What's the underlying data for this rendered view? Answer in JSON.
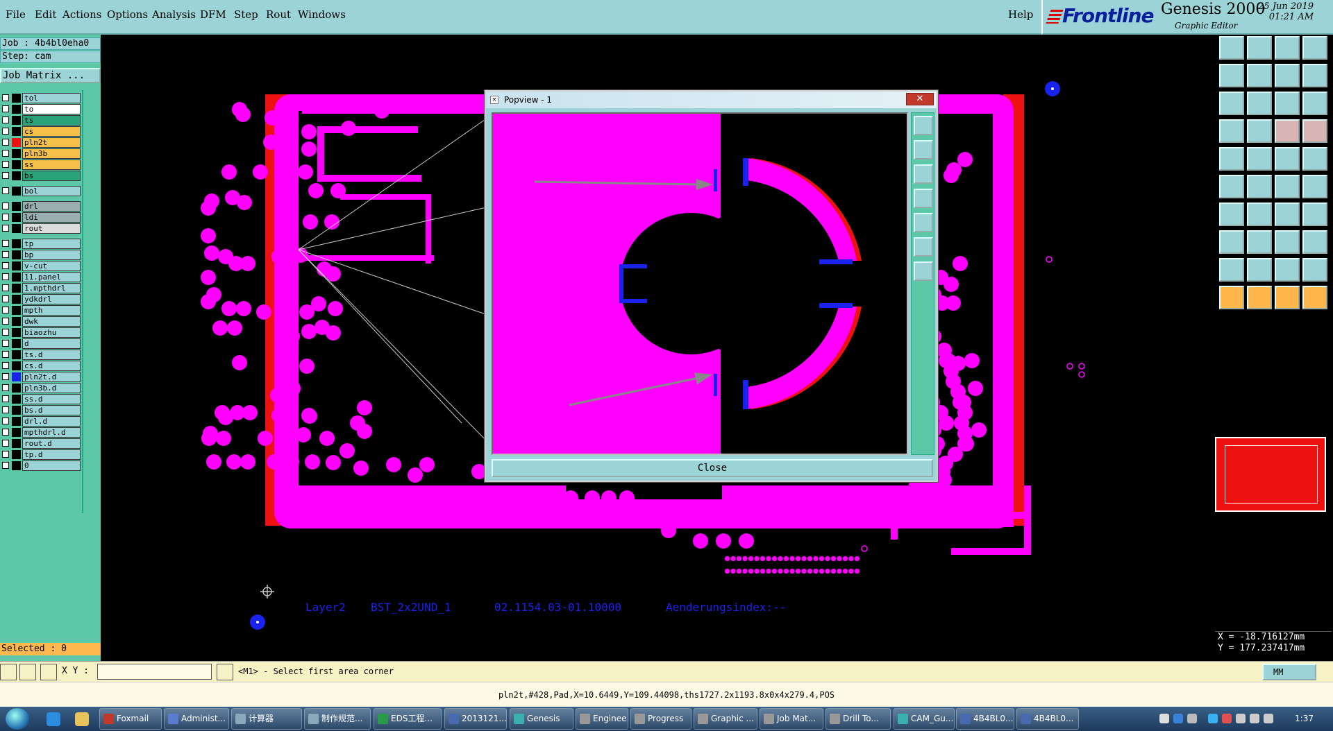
{
  "menu": {
    "items": [
      "File",
      "Edit",
      "Actions",
      "Options",
      "Analysis",
      "DFM",
      "Step",
      "Rout",
      "Windows"
    ],
    "help": "Help"
  },
  "brand": {
    "logo": "Frontline",
    "product": "Genesis 2000",
    "subtitle": "Graphic Editor",
    "date": "25 Jun 2019",
    "time": "01:21 AM"
  },
  "job": {
    "job_line": "Job : 4b4bl0eha0",
    "step_line": "Step: cam",
    "matrix_button": "Job Matrix ..."
  },
  "layers": [
    {
      "name": "tol",
      "color": "#9bd3d6",
      "swatch": "#000"
    },
    {
      "name": "to",
      "color": "#ffffff",
      "swatch": "#000"
    },
    {
      "name": "ts",
      "color": "#2aa37a",
      "swatch": "#000"
    },
    {
      "name": "cs",
      "color": "#f4c04a",
      "swatch": "#000"
    },
    {
      "name": "pln2t",
      "color": "#f4c04a",
      "swatch": "#ee1111"
    },
    {
      "name": "pln3b",
      "color": "#f4c04a",
      "swatch": "#000"
    },
    {
      "name": "ss",
      "color": "#f4c04a",
      "swatch": "#000"
    },
    {
      "name": "bs",
      "color": "#2aa37a",
      "swatch": "#000"
    },
    {
      "name": "bol",
      "color": "#9bd3d6",
      "swatch": "#000"
    },
    {
      "name": "drl",
      "color": "#9ab0b0",
      "swatch": "#000"
    },
    {
      "name": "ldi",
      "color": "#9ab0b0",
      "swatch": "#000"
    },
    {
      "name": "rout",
      "color": "#dcdcdc",
      "swatch": "#000"
    },
    {
      "name": "tp",
      "color": "#9bd3d6",
      "swatch": "#000"
    },
    {
      "name": "bp",
      "color": "#9bd3d6",
      "swatch": "#000"
    },
    {
      "name": "v-cut",
      "color": "#9bd3d6",
      "swatch": "#000"
    },
    {
      "name": "11.panel",
      "color": "#9bd3d6",
      "swatch": "#000"
    },
    {
      "name": "1.mpthdrl",
      "color": "#9bd3d6",
      "swatch": "#000"
    },
    {
      "name": "ydkdrl",
      "color": "#9bd3d6",
      "swatch": "#000"
    },
    {
      "name": "mpth",
      "color": "#9bd3d6",
      "swatch": "#000"
    },
    {
      "name": "dwk",
      "color": "#9bd3d6",
      "swatch": "#000"
    },
    {
      "name": "biaozhu",
      "color": "#9bd3d6",
      "swatch": "#000"
    },
    {
      "name": "d",
      "color": "#9bd3d6",
      "swatch": "#000"
    },
    {
      "name": "ts.d",
      "color": "#9bd3d6",
      "swatch": "#000"
    },
    {
      "name": "cs.d",
      "color": "#9bd3d6",
      "swatch": "#000"
    },
    {
      "name": "pln2t.d",
      "color": "#9bd3d6",
      "swatch": "#1a22ee"
    },
    {
      "name": "pln3b.d",
      "color": "#9bd3d6",
      "swatch": "#000"
    },
    {
      "name": "ss.d",
      "color": "#9bd3d6",
      "swatch": "#000"
    },
    {
      "name": "bs.d",
      "color": "#9bd3d6",
      "swatch": "#000"
    },
    {
      "name": "drl.d",
      "color": "#9bd3d6",
      "swatch": "#000"
    },
    {
      "name": "mpthdrl.d",
      "color": "#9bd3d6",
      "swatch": "#000"
    },
    {
      "name": "rout.d",
      "color": "#9bd3d6",
      "swatch": "#000"
    },
    {
      "name": "tp.d",
      "color": "#9bd3d6",
      "swatch": "#000"
    },
    {
      "name": "0",
      "color": "#9bd3d6",
      "swatch": "#000"
    }
  ],
  "selected": "Selected : 0",
  "board": {
    "silk_text_1": "Layer2",
    "silk_text_2": "BST_2x2UND_1",
    "silk_text_3": "02.1154.03-01.10000",
    "silk_text_4": "Aenderungsindex:--"
  },
  "popview": {
    "title": "Popview - 1",
    "close_label": "Close",
    "close_x": "✕"
  },
  "coords": {
    "x": "X = -18.716127mm",
    "y": "Y = 177.237417mm"
  },
  "command": {
    "xy_label": "X Y :",
    "xy_value": "",
    "prompt": "<M1> - Select first area corner",
    "units": "MM"
  },
  "status_line": "pln2t,#428,Pad,X=10.6449,Y=109.44098,ths1727.2x1193.8x0x4x279.4,POS",
  "taskbar": {
    "buttons": [
      "Foxmail",
      "Administ...",
      "计算器",
      "制作规范...",
      "EDS工程...",
      "2013121...",
      "Genesis",
      "Enginee...",
      "Progress",
      "Graphic ...",
      "Job Mat...",
      "Drill To...",
      "CAM_Gu...",
      "4B4BL0...",
      "4B4BL0..."
    ],
    "clock": "1:37"
  },
  "colors": {
    "copper": "#ff00ff",
    "outline": "#ee1111",
    "annot": "#1a22ee",
    "panel": "#5cc8a8",
    "menu": "#9bd3d6"
  }
}
